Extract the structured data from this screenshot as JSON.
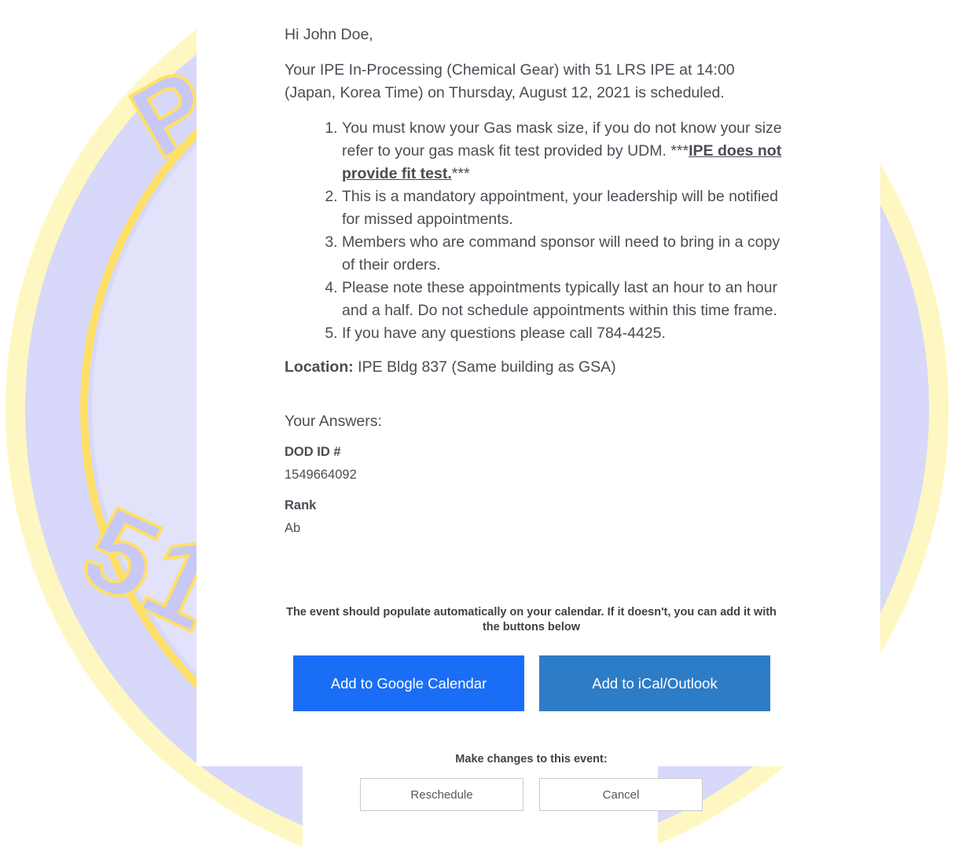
{
  "colors": {
    "background_badge": "#d8d8fa",
    "badge_accent": "#ffe066",
    "google_button": "#1a6ef5",
    "ical_button": "#2d7cc6"
  },
  "email": {
    "greeting": "Hi John Doe,",
    "intro": "Your IPE In-Processing (Chemical Gear) with 51 LRS IPE at 14:00 (Japan, Korea Time) on Thursday, August 12, 2021 is scheduled.",
    "instructions": {
      "item1_text": "You must know your Gas mask size, if you do not know your size refer to your gas mask fit test provided by UDM. ***",
      "item1_emphasis": "IPE does not provide fit test.",
      "item1_suffix": "***",
      "item2": "This is a mandatory appointment, your leadership will be notified for missed appointments.",
      "item3": "Members who are command sponsor will need to bring in a copy of their orders.",
      "item4": "Please note these appointments typically last an hour to an hour and a half. Do not schedule appointments within this time frame.",
      "item5": "If you have any questions please call 784-4425."
    },
    "location_label": "Location:",
    "location_value": " IPE Bldg 837 (Same building as GSA)",
    "answers_title": "Your Answers:",
    "answers": [
      {
        "label": "DOD ID #",
        "value": "1549664092"
      },
      {
        "label": "Rank",
        "value": "Ab"
      }
    ]
  },
  "calendar": {
    "notice": "The event should populate automatically on your calendar. If it doesn't, you can add it with the buttons below",
    "google_label": "Add to Google Calendar",
    "ical_label": "Add to iCal/Outlook"
  },
  "changes": {
    "title": "Make changes to this event:",
    "reschedule_label": "Reschedule",
    "cancel_label": "Cancel"
  }
}
